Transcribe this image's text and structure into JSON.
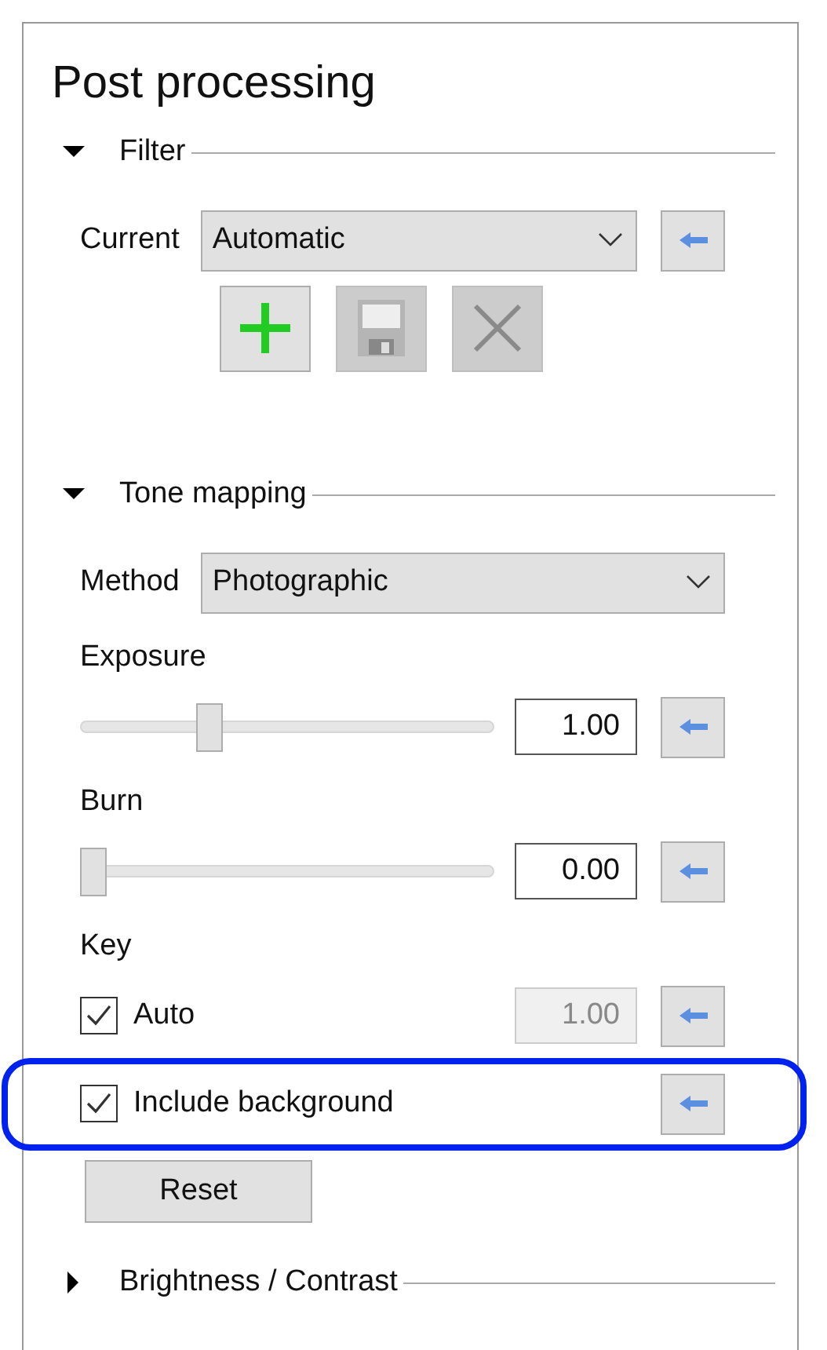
{
  "panel": {
    "title": "Post processing"
  },
  "sections": [
    {
      "title": "Filter",
      "expanded": true,
      "rows": [
        {
          "kind": "combo_reset",
          "label": "Current",
          "value": "Automatic"
        },
        {
          "kind": "toolbar",
          "buttons": [
            {
              "kind": "add",
              "disabled": false
            },
            {
              "kind": "save",
              "disabled": true
            },
            {
              "kind": "delete",
              "disabled": true
            }
          ]
        }
      ]
    },
    {
      "title": "Tone mapping",
      "expanded": true,
      "rows": [
        {
          "kind": "combo",
          "label": "Method",
          "value": "Photographic"
        },
        {
          "kind": "label",
          "label": "Exposure"
        },
        {
          "kind": "slider",
          "level": 0.3,
          "value": "1.00"
        },
        {
          "kind": "label",
          "label": "Burn"
        },
        {
          "kind": "slider",
          "level": 0.0,
          "value": "0.00"
        },
        {
          "kind": "label",
          "label": "Key"
        },
        {
          "kind": "checkbox",
          "label": "Auto",
          "checked": true,
          "value": "1.00",
          "disabled": true,
          "highlighted": false
        },
        {
          "kind": "checkbox",
          "label": "Include background",
          "checked": true,
          "highlighted": true
        },
        {
          "kind": "button",
          "label": "Reset"
        }
      ]
    },
    {
      "title": "Brightness / Contrast",
      "expanded": false
    }
  ]
}
